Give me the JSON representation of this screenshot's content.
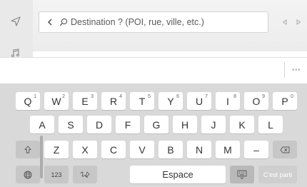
{
  "search": {
    "placeholder": "Destination ? (POI, rue, ville, etc.)",
    "value": ""
  },
  "icons": {
    "navigation": "navigation-arrow-icon",
    "music": "music-note-icon",
    "back": "chevron-left-icon",
    "search": "magnifier-icon",
    "prev": "triangle-left-icon",
    "next": "triangle-right-icon",
    "more": "more-icon",
    "shift": "shift-icon",
    "backspace": "backspace-icon",
    "globe": "globe-icon",
    "handwriting": "handwriting-icon",
    "hide_keyboard": "hide-keyboard-icon"
  },
  "strip": {
    "more_label": "•••"
  },
  "keyboard": {
    "row1": [
      {
        "label": "Q",
        "sup": "1"
      },
      {
        "label": "W",
        "sup": "2"
      },
      {
        "label": "E",
        "sup": "3"
      },
      {
        "label": "R",
        "sup": "4"
      },
      {
        "label": "T",
        "sup": "5"
      },
      {
        "label": "Y",
        "sup": "6"
      },
      {
        "label": "U",
        "sup": "7"
      },
      {
        "label": "I",
        "sup": "8"
      },
      {
        "label": "O",
        "sup": "9"
      },
      {
        "label": "P",
        "sup": "0"
      }
    ],
    "row2": [
      "A",
      "S",
      "D",
      "F",
      "G",
      "H",
      "J",
      "K",
      "L"
    ],
    "row3": [
      "Z",
      "X",
      "C",
      "V",
      "B",
      "N",
      "M",
      "–"
    ],
    "numbers_label": "123",
    "space_label": "Espace",
    "go_label": "C'est parti"
  },
  "colors": {
    "keyboard_bg": "#d9d9d9",
    "key_bg": "#ffffff",
    "fn_key_bg": "#c7c7c7",
    "icon_gray": "#8a8a8a"
  }
}
